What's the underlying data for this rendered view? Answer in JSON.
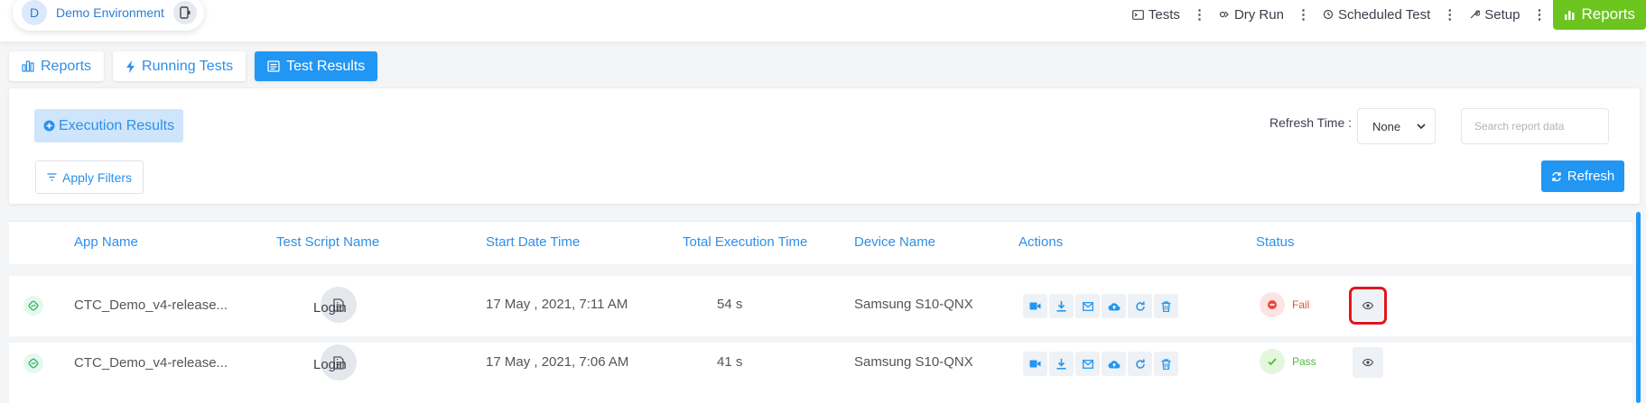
{
  "env": {
    "avatar": "D",
    "label": "Demo Environment"
  },
  "nav": {
    "tests": "Tests",
    "dry_run": "Dry Run",
    "scheduled": "Scheduled Test",
    "setup": "Setup",
    "reports": "Reports"
  },
  "tabs": [
    {
      "label": "Reports"
    },
    {
      "label": "Running Tests"
    },
    {
      "label": "Test Results"
    }
  ],
  "filters": {
    "execution_results": "Execution Results",
    "apply_filters": "Apply Filters",
    "refresh_time_label": "Refresh Time :",
    "refresh_time_value": "None",
    "search_placeholder": "Search report data",
    "refresh": "Refresh"
  },
  "table": {
    "headers": [
      "App Name",
      "Test Script Name",
      "Start Date Time",
      "Total Execution Time",
      "Device Name",
      "Actions",
      "Status"
    ],
    "rows": [
      {
        "app": "CTC_Demo_v4-release...",
        "script": "Login",
        "start": "17 May , 2021, 7:11 AM",
        "duration": "54 s",
        "device": "Samsung S10-QNX",
        "status": "Fail"
      },
      {
        "app": "CTC_Demo_v4-release...",
        "script": "Login",
        "start": "17 May , 2021, 7:06 AM",
        "duration": "41 s",
        "device": "Samsung S10-QNX",
        "status": "Pass"
      }
    ]
  },
  "icons": {
    "actions": [
      "video-icon",
      "download-icon",
      "email-icon",
      "cloud-upload-icon",
      "rerun-icon",
      "delete-icon"
    ],
    "view": "eye-icon"
  },
  "colors": {
    "accent": "#2196f3",
    "reports_green": "#6cc51f",
    "fail": "#e74c3c",
    "pass": "#4cbb3a",
    "highlight": "#e3151c"
  }
}
